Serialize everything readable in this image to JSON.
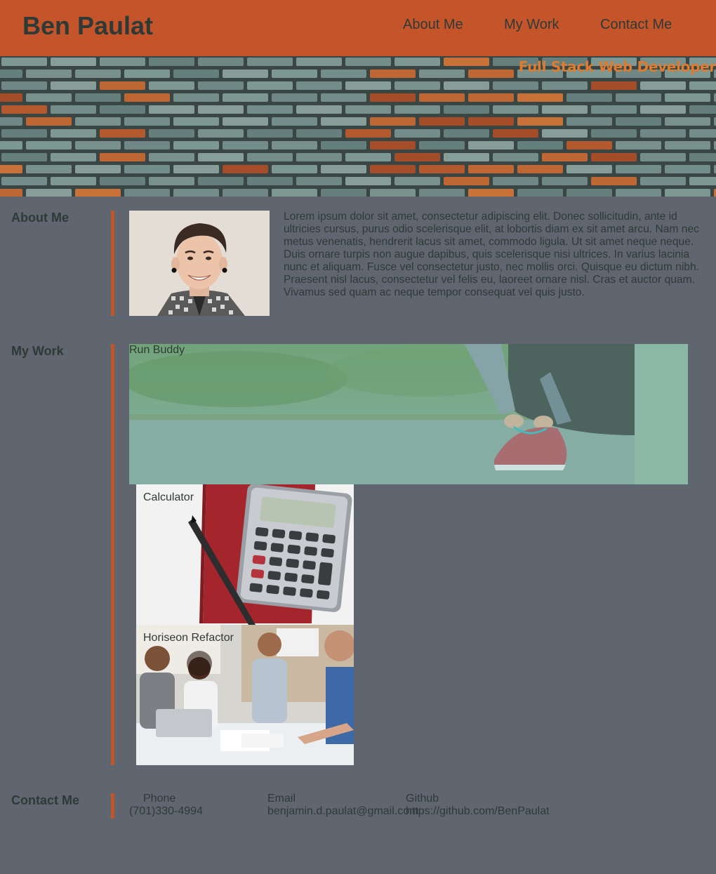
{
  "header": {
    "brand": "Ben Paulat",
    "nav": [
      "About Me",
      "My Work",
      "Contact Me"
    ]
  },
  "hero": {
    "title": "Full Stack Web Developer"
  },
  "about": {
    "heading": "About Me",
    "text": "Lorem ipsum dolor sit amet, consectetur adipiscing elit. Donec sollicitudin, ante id ultricies cursus, purus odio scelerisque elit, at lobortis diam ex sit amet arcu. Nam nec metus venenatis, hendrerit lacus sit amet, commodo ligula. Ut sit amet neque neque. Duis ornare turpis non augue dapibus, quis scelerisque nisi ultrices. In varius lacinia nunc et aliquam. Fusce vel consectetur justo, nec mollis orci. Quisque eu dictum nibh. Praesent nisl lacus, consectetur vel felis eu, laoreet ornare nisl. Cras et auctor quam. Vivamus sed quam ac neque tempor consequat vel quis justo."
  },
  "work": {
    "heading": "My Work",
    "projects": [
      {
        "title": "Run Buddy"
      },
      {
        "title": "Calculator"
      },
      {
        "title": "Horiseon Refactor"
      }
    ]
  },
  "contact": {
    "heading": "Contact Me",
    "phone_label": "Phone",
    "phone": "(701)330-4994",
    "email_label": "Email",
    "email": "benjamin.d.paulat@gmail.com",
    "github_label": "Github",
    "github": "https://github.com/BenPaulat"
  },
  "colors": {
    "accent": "#c4552b",
    "background": "#5f6670",
    "text": "#2f3a36",
    "hero_title": "#de7b30"
  }
}
